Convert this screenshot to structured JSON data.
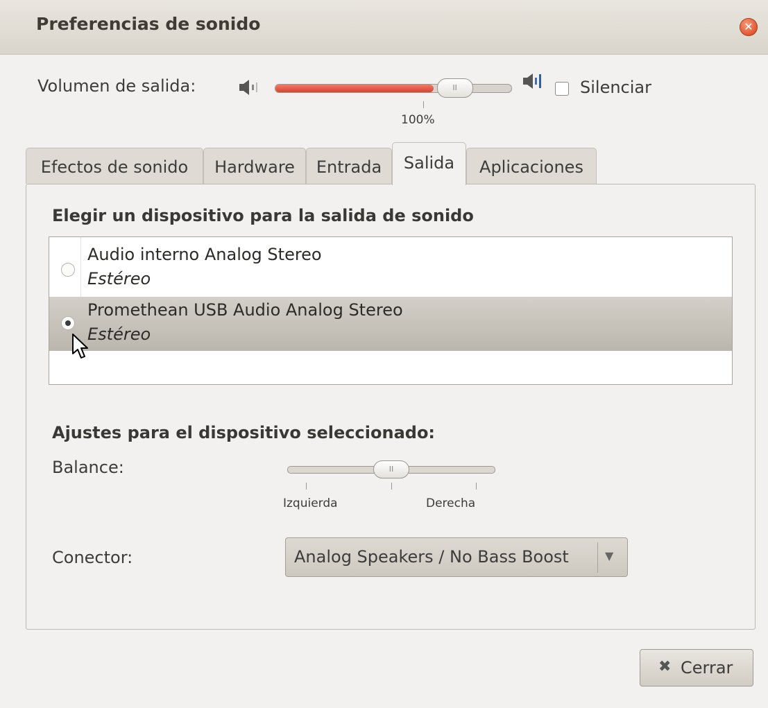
{
  "window": {
    "title": "Preferencias de sonido"
  },
  "volume": {
    "label": "Volumen de salida:",
    "level_percent": 100,
    "mark_label": "100%",
    "mute_label": "Silenciar",
    "mute_checked": false
  },
  "tabs": [
    {
      "label": "Efectos de sonido",
      "active": false
    },
    {
      "label": "Hardware",
      "active": false
    },
    {
      "label": "Entrada",
      "active": false
    },
    {
      "label": "Salida",
      "active": true
    },
    {
      "label": "Aplicaciones",
      "active": false
    }
  ],
  "output": {
    "heading": "Elegir un dispositivo para la salida de sonido",
    "devices": [
      {
        "name": "Audio interno Analog Stereo",
        "profile": "Estéreo",
        "selected": false
      },
      {
        "name": "Promethean USB Audio Analog Stereo",
        "profile": "Estéreo",
        "selected": true
      }
    ]
  },
  "settings": {
    "heading": "Ajustes para el dispositivo seleccionado:",
    "balance_label": "Balance:",
    "balance_left": "Izquierda",
    "balance_right": "Derecha",
    "balance_value": 0.5,
    "connector_label": "Conector:",
    "connector_value": "Analog Speakers / No Bass Boost"
  },
  "buttons": {
    "close": "Cerrar"
  },
  "colors": {
    "volume_fill": "#e0533d",
    "selected_row": "#c4c0b8"
  }
}
